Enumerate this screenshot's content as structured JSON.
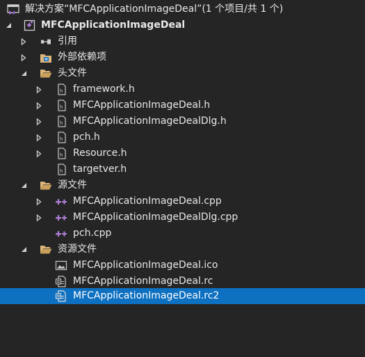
{
  "solution": {
    "label": "解决方案“MFCApplicationImageDeal”(1 个项目/共 1 个)",
    "icon": "solution-icon"
  },
  "project": {
    "label": "MFCApplicationImageDeal",
    "icon": "cpp-project-icon"
  },
  "nodes": {
    "references": {
      "label": "引用",
      "icon": "references-icon"
    },
    "external": {
      "label": "外部依赖项",
      "icon": "external-dependencies-icon"
    },
    "headers": {
      "label": "头文件",
      "icon": "folder-icon"
    },
    "sources": {
      "label": "源文件",
      "icon": "folder-icon"
    },
    "resources": {
      "label": "资源文件",
      "icon": "folder-icon"
    }
  },
  "header_files": [
    {
      "label": "framework.h"
    },
    {
      "label": "MFCApplicationImageDeal.h"
    },
    {
      "label": "MFCApplicationImageDealDlg.h"
    },
    {
      "label": "pch.h"
    },
    {
      "label": "Resource.h"
    },
    {
      "label": "targetver.h"
    }
  ],
  "source_files": [
    {
      "label": "MFCApplicationImageDeal.cpp"
    },
    {
      "label": "MFCApplicationImageDealDlg.cpp"
    },
    {
      "label": "pch.cpp"
    }
  ],
  "resource_files": [
    {
      "label": "MFCApplicationImageDeal.ico",
      "icon": "image-file-icon"
    },
    {
      "label": "MFCApplicationImageDeal.rc",
      "icon": "resource-file-icon"
    },
    {
      "label": "MFCApplicationImageDeal.rc2",
      "icon": "resource-file-icon",
      "selected": true
    }
  ],
  "colors": {
    "background": "#252526",
    "selection": "#0e70c0",
    "text": "#e8e8e8",
    "folder": "#dcb67a",
    "cpp_accent": "#b180d7",
    "arrow": "#cfcfcf"
  }
}
